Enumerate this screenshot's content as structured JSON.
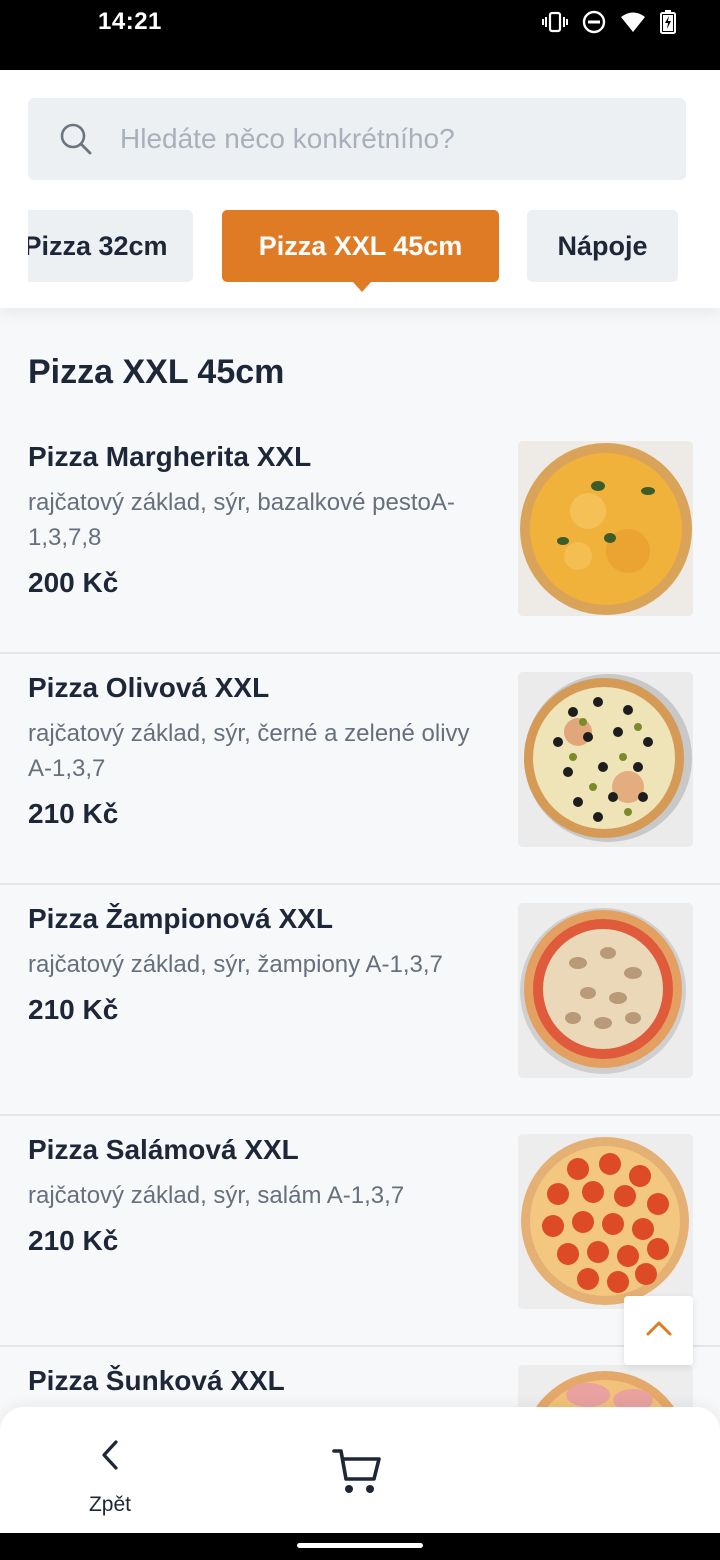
{
  "status_bar": {
    "time": "14:21",
    "icons": [
      "vibrate-icon",
      "do-not-disturb-icon",
      "wifi-icon",
      "battery-icon"
    ]
  },
  "search": {
    "placeholder": "Hledáte něco konkrétního?",
    "value": ""
  },
  "tabs": [
    {
      "label": "Pizza 32cm",
      "active": false
    },
    {
      "label": "Pizza XXL 45cm",
      "active": true
    },
    {
      "label": "Nápoje",
      "active": false
    }
  ],
  "section": {
    "title": "Pizza XXL 45cm"
  },
  "items": [
    {
      "name": "Pizza Margherita XXL",
      "description": "rajčatový základ, sýr, bazalkové pestoA-1,3,7,8",
      "price": "200 Kč",
      "image": "margherita"
    },
    {
      "name": "Pizza Olivová XXL",
      "description": "rajčatový základ, sýr, černé a zelené olivy A-1,3,7",
      "price": "210 Kč",
      "image": "olive"
    },
    {
      "name": "Pizza Žampionová XXL",
      "description": "rajčatový základ, sýr, žampiony A-1,3,7",
      "price": "210 Kč",
      "image": "mushroom"
    },
    {
      "name": "Pizza Salámová XXL",
      "description": "rajčatový základ, sýr, salám A-1,3,7",
      "price": "210 Kč",
      "image": "salami"
    },
    {
      "name": "Pizza Šunková XXL",
      "description": "",
      "price": "",
      "image": "ham"
    }
  ],
  "bottom_nav": {
    "back_label": "Zpět",
    "cart_icon": "cart-icon"
  },
  "colors": {
    "accent": "#e07b25",
    "text": "#1d2738",
    "muted": "#66707d",
    "chip_bg": "#edf0f3"
  }
}
